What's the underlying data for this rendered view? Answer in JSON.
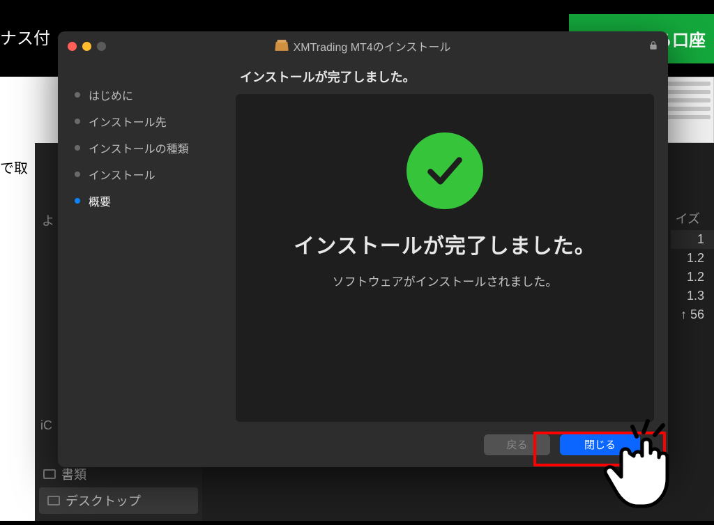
{
  "background": {
    "top_left_partial": "ナス付",
    "green_button_partial": "こちらから口座",
    "left_mid_partial": "で取",
    "finder": {
      "sidebar_label_yo": "よ",
      "sidebar_ic": "iC",
      "sidebar_item_books": "書類",
      "sidebar_item_desktop": "デスクトップ",
      "col_header_size_partial": "イズ",
      "vals": [
        "1",
        "1.2",
        "1.2",
        "1.3",
        "↑ 56"
      ]
    }
  },
  "installer": {
    "title": "XMTrading MT4のインストール",
    "steps": [
      {
        "label": "はじめに",
        "active": false
      },
      {
        "label": "インストール先",
        "active": false
      },
      {
        "label": "インストールの種類",
        "active": false
      },
      {
        "label": "インストール",
        "active": false
      },
      {
        "label": "概要",
        "active": true
      }
    ],
    "heading": "インストールが完了しました。",
    "result_big": "インストールが完了しました。",
    "result_sub": "ソフトウェアがインストールされました。",
    "buttons": {
      "back": "戻る",
      "close": "閉じる"
    }
  }
}
